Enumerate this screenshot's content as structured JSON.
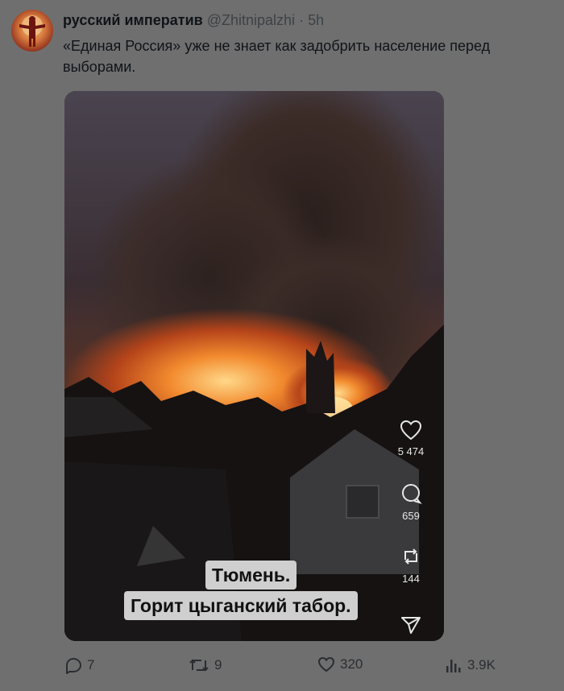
{
  "author": {
    "display_name": "русский императив",
    "handle": "@Zhitnipalzhi",
    "separator": "·",
    "time": "5h"
  },
  "tweet": {
    "text": "«Единая Россия» уже не знает как задобрить население перед выборами."
  },
  "video": {
    "caption_line1": "Тюмень.",
    "caption_line2": "Горит цыганский табор.",
    "side_actions": [
      {
        "icon": "heart-icon",
        "count": "5 474"
      },
      {
        "icon": "comment-icon",
        "count": "659"
      },
      {
        "icon": "repost-icon",
        "count": "144"
      },
      {
        "icon": "share-icon",
        "count": ""
      }
    ]
  },
  "actions": {
    "replies": "7",
    "reposts": "9",
    "likes": "320",
    "views": "3.9K"
  }
}
